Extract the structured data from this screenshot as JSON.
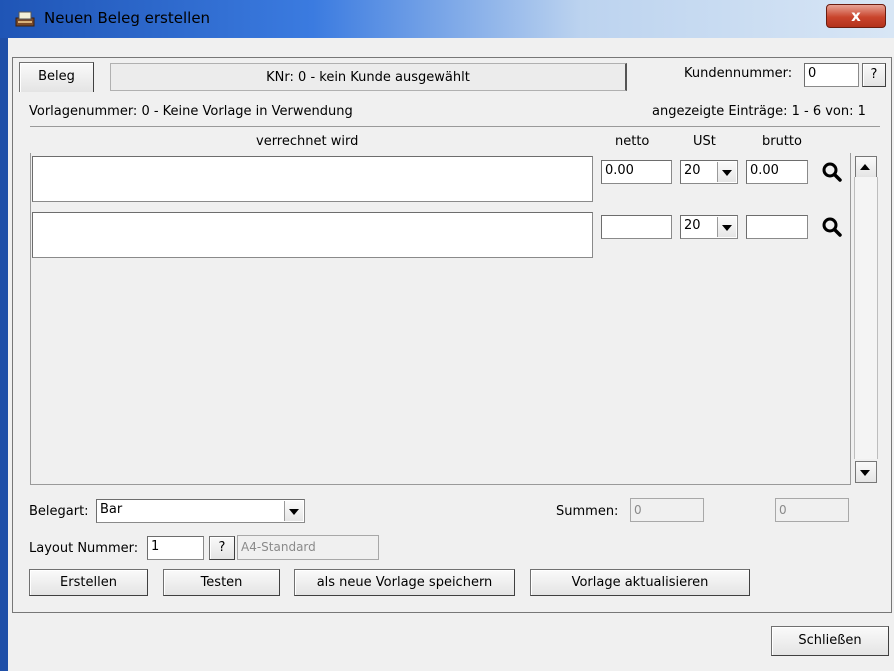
{
  "window": {
    "title": "Neuen Beleg erstellen",
    "close_label": "x"
  },
  "header": {
    "tab_label": "Beleg",
    "customer_status": "KNr: 0 - kein Kunde ausgewählt",
    "customer_number_label": "Kundennummer:",
    "customer_number_value": "0",
    "help_label": "?"
  },
  "info": {
    "template_label": "Vorlagenummer: 0 - Keine Vorlage in Verwendung",
    "entries_label": "angezeigte Einträge: 1 - 6 von: 1"
  },
  "columns": {
    "description": "verrechnet wird",
    "net": "netto",
    "vat": "USt",
    "gross": "brutto"
  },
  "rows": [
    {
      "description": "",
      "net": "0.00",
      "vat": "20",
      "gross": "0.00"
    },
    {
      "description": "",
      "net": "",
      "vat": "20",
      "gross": ""
    }
  ],
  "footer": {
    "doc_type_label": "Belegart:",
    "doc_type_value": "Bar",
    "sums_label": "Summen:",
    "sum_net": "0",
    "sum_gross": "0",
    "layout_label": "Layout Nummer:",
    "layout_value": "1",
    "layout_help": "?",
    "layout_name": "A4-Standard"
  },
  "buttons": {
    "create": "Erstellen",
    "test": "Testen",
    "save_template": "als neue Vorlage speichern",
    "update_template": "Vorlage aktualisieren",
    "close": "Schließen"
  },
  "icons": {
    "app": "typewriter-icon",
    "search": "magnifier-icon",
    "scroll_up": "arrow-up-icon",
    "scroll_down": "arrow-down-icon",
    "dropdown": "chevron-down-icon"
  },
  "colors": {
    "titlebar_start": "#1f55b6",
    "titlebar_end": "#d8e6f5",
    "close_button": "#c9452d",
    "window_background": "#f0f0f0"
  }
}
